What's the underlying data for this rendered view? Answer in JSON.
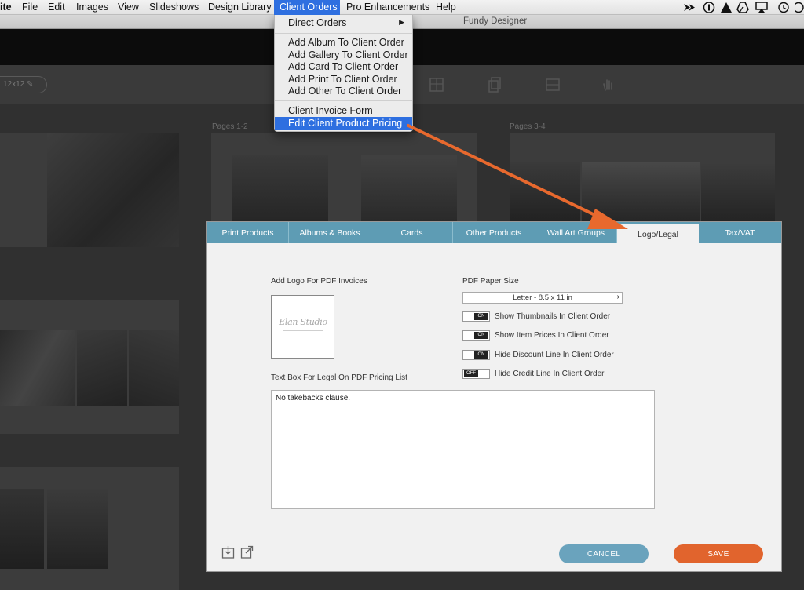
{
  "menubar": {
    "app_fragment": "ite",
    "items": [
      "File",
      "Edit",
      "Images",
      "View",
      "Slideshows",
      "Design Library"
    ],
    "active_menu": "Client Orders",
    "items_after": [
      "Pro Enhancements",
      "Help"
    ],
    "tray_icons": [
      "send-arrow-icon",
      "info-circle-icon",
      "warning-triangle-icon",
      "drive-icon",
      "airplay-icon",
      "time-machine-icon",
      "more-icon"
    ]
  },
  "window": {
    "title": "Fundy Designer"
  },
  "workspace": {
    "size_label": "12x12",
    "spread_labels": [
      "Pages 1-2",
      "Pages 3-4"
    ]
  },
  "dropdown": {
    "submenu_item": "Direct Orders",
    "add_items": [
      "Add Album To Client Order",
      "Add Gallery To Client Order",
      "Add Card To Client Order",
      "Add Print To Client Order",
      "Add Other To Client Order"
    ],
    "invoice_item": "Client Invoice Form",
    "highlighted_item": "Edit Client Product Pricing"
  },
  "dialog": {
    "tabs": [
      "Print Products",
      "Albums & Books",
      "Cards",
      "Other Products",
      "Wall Art Groups",
      "Logo/Legal",
      "Tax/VAT"
    ],
    "active_tab": "Logo/Legal",
    "logo_label": "Add Logo For PDF Invoices",
    "logo_text": "Elan Studio",
    "paper_label": "PDF Paper Size",
    "paper_value": "Letter - 8.5 x 11 in",
    "options": [
      {
        "label": "Show Thumbnails In Client Order",
        "state": "ON"
      },
      {
        "label": "Show Item Prices In Client Order",
        "state": "ON"
      },
      {
        "label": "Hide Discount Line In Client Order",
        "state": "ON"
      },
      {
        "label": "Hide Credit Line In Client Order",
        "state": "OFF"
      }
    ],
    "legal_label": "Text Box For Legal On PDF Pricing List",
    "legal_text": "No takebacks clause.",
    "cancel_label": "CANCEL",
    "save_label": "SAVE"
  },
  "colors": {
    "tab_bar": "#5e9cb4",
    "cancel": "#6aa3bd",
    "save": "#e1642d",
    "menu_highlight": "#2e6fe0",
    "annotation_arrow": "#e8692e"
  }
}
